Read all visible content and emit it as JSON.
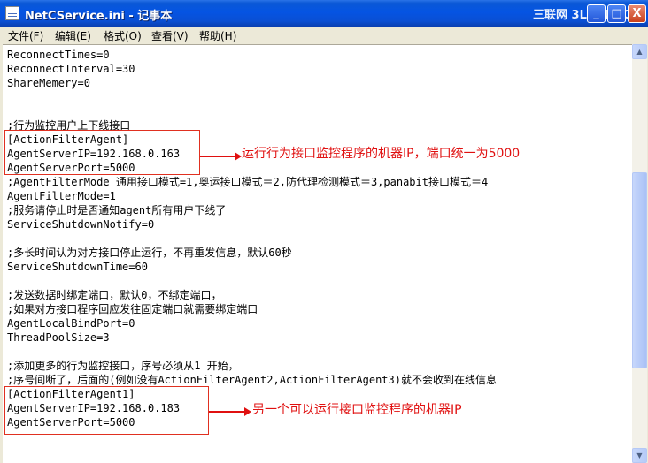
{
  "window": {
    "title": "NetCService.ini - 记事本",
    "watermark": "三联网 3LIAN.COM",
    "controls": {
      "minimize": "_",
      "maximize": "□",
      "close": "X"
    }
  },
  "menu": [
    "文件(F)",
    "编辑(E)",
    "格式(O)",
    "查看(V)",
    "帮助(H)"
  ],
  "editor_lines": [
    "ReconnectTimes=0",
    "ReconnectInterval=30",
    "ShareMemery=0",
    "",
    "",
    ";行为监控用户上下线接口",
    "[ActionFilterAgent]",
    "AgentServerIP=192.168.0.163",
    "AgentServerPort=5000",
    ";AgentFilterMode 通用接口模式=1,奥运接口模式＝2,防代理检测模式＝3,panabit接口模式＝4",
    "AgentFilterMode=1",
    ";服务请停止时是否通知agent所有用户下线了",
    "ServiceShutdownNotify=0",
    "",
    ";多长时间认为对方接口停止运行，不再重发信息，默认60秒",
    "ServiceShutdownTime=60",
    "",
    ";发送数据时绑定端口，默认0，不绑定端口，",
    ";如果对方接口程序回应发往固定端口就需要绑定端口",
    "AgentLocalBindPort=0",
    "ThreadPoolSize=3",
    "",
    ";添加更多的行为监控接口，序号必须从1 开始，",
    ";序号间断了，后面的(例如没有ActionFilterAgent2,ActionFilterAgent3)就不会收到在线信息",
    "[ActionFilterAgent1]",
    "AgentServerIP=192.168.0.183",
    "AgentServerPort=5000"
  ],
  "annotations": [
    "运行行为接口监控程序的机器IP，端口统一为5000",
    "另一个可以运行接口监控程序的机器IP"
  ],
  "scrollbar": {
    "up": "▲",
    "down": "▼"
  },
  "colors": {
    "titlebar": "#0554e3",
    "annotation": "#e01010",
    "editor_bg": "#ffffff"
  }
}
